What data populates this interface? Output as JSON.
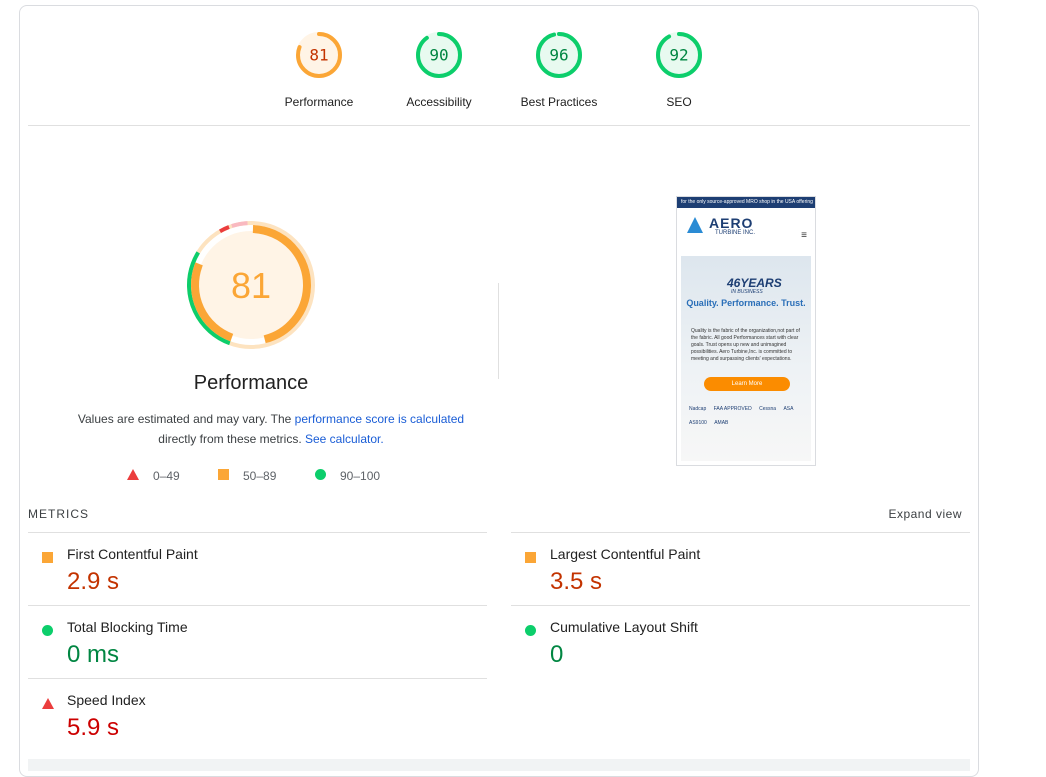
{
  "categories": [
    {
      "score": "81",
      "label": "Performance",
      "fraction": 0.81,
      "status": "average"
    },
    {
      "score": "90",
      "label": "Accessibility",
      "fraction": 0.9,
      "status": "pass"
    },
    {
      "score": "96",
      "label": "Best Practices",
      "fraction": 0.96,
      "status": "pass"
    },
    {
      "score": "92",
      "label": "SEO",
      "fraction": 0.92,
      "status": "pass"
    }
  ],
  "performance": {
    "score": "81",
    "title": "Performance",
    "desc_prefix": "Values are estimated and may vary. The ",
    "desc_link": "performance score is calculated",
    "desc_middle": "directly from these metrics. ",
    "desc_link2": "See calculator.",
    "legend": {
      "fail": "0–49",
      "average": "50–89",
      "pass": "90–100"
    }
  },
  "screenshot": {
    "topbar": "for the only source-approved MRO shop in the USA offering",
    "logo": "AERO",
    "logo_sub": "TURBINE INC.",
    "years": "46YEARS",
    "years_sub": "IN BUSINESS",
    "tagline": "Quality. Performance. Trust.",
    "paragraph": "Quality is the fabric of the organization,not part of the fabric. All good Performances start with clear goals. Trust opens up new and unimagined possibilities. Aero Turbine,Inc. is committed to meeting and surpassing clients' expectations.",
    "button": "Learn More",
    "logos": [
      "Nadcap",
      "FAA APPROVED",
      "Cessna",
      "ASA",
      "AS9100",
      "AMAB"
    ]
  },
  "metrics_heading": "METRICS",
  "expand_label": "Expand view",
  "metrics": [
    {
      "name": "First Contentful Paint",
      "value": "2.9 s",
      "status": "average"
    },
    {
      "name": "Largest Contentful Paint",
      "value": "3.5 s",
      "status": "average"
    },
    {
      "name": "Total Blocking Time",
      "value": "0 ms",
      "status": "pass"
    },
    {
      "name": "Cumulative Layout Shift",
      "value": "0",
      "status": "pass"
    },
    {
      "name": "Speed Index",
      "value": "5.9 s",
      "status": "fail"
    }
  ],
  "colors": {
    "pass": "#0cce6b",
    "average": "#fba636",
    "fail": "#eb3d3d",
    "link": "#1a5dd6"
  }
}
